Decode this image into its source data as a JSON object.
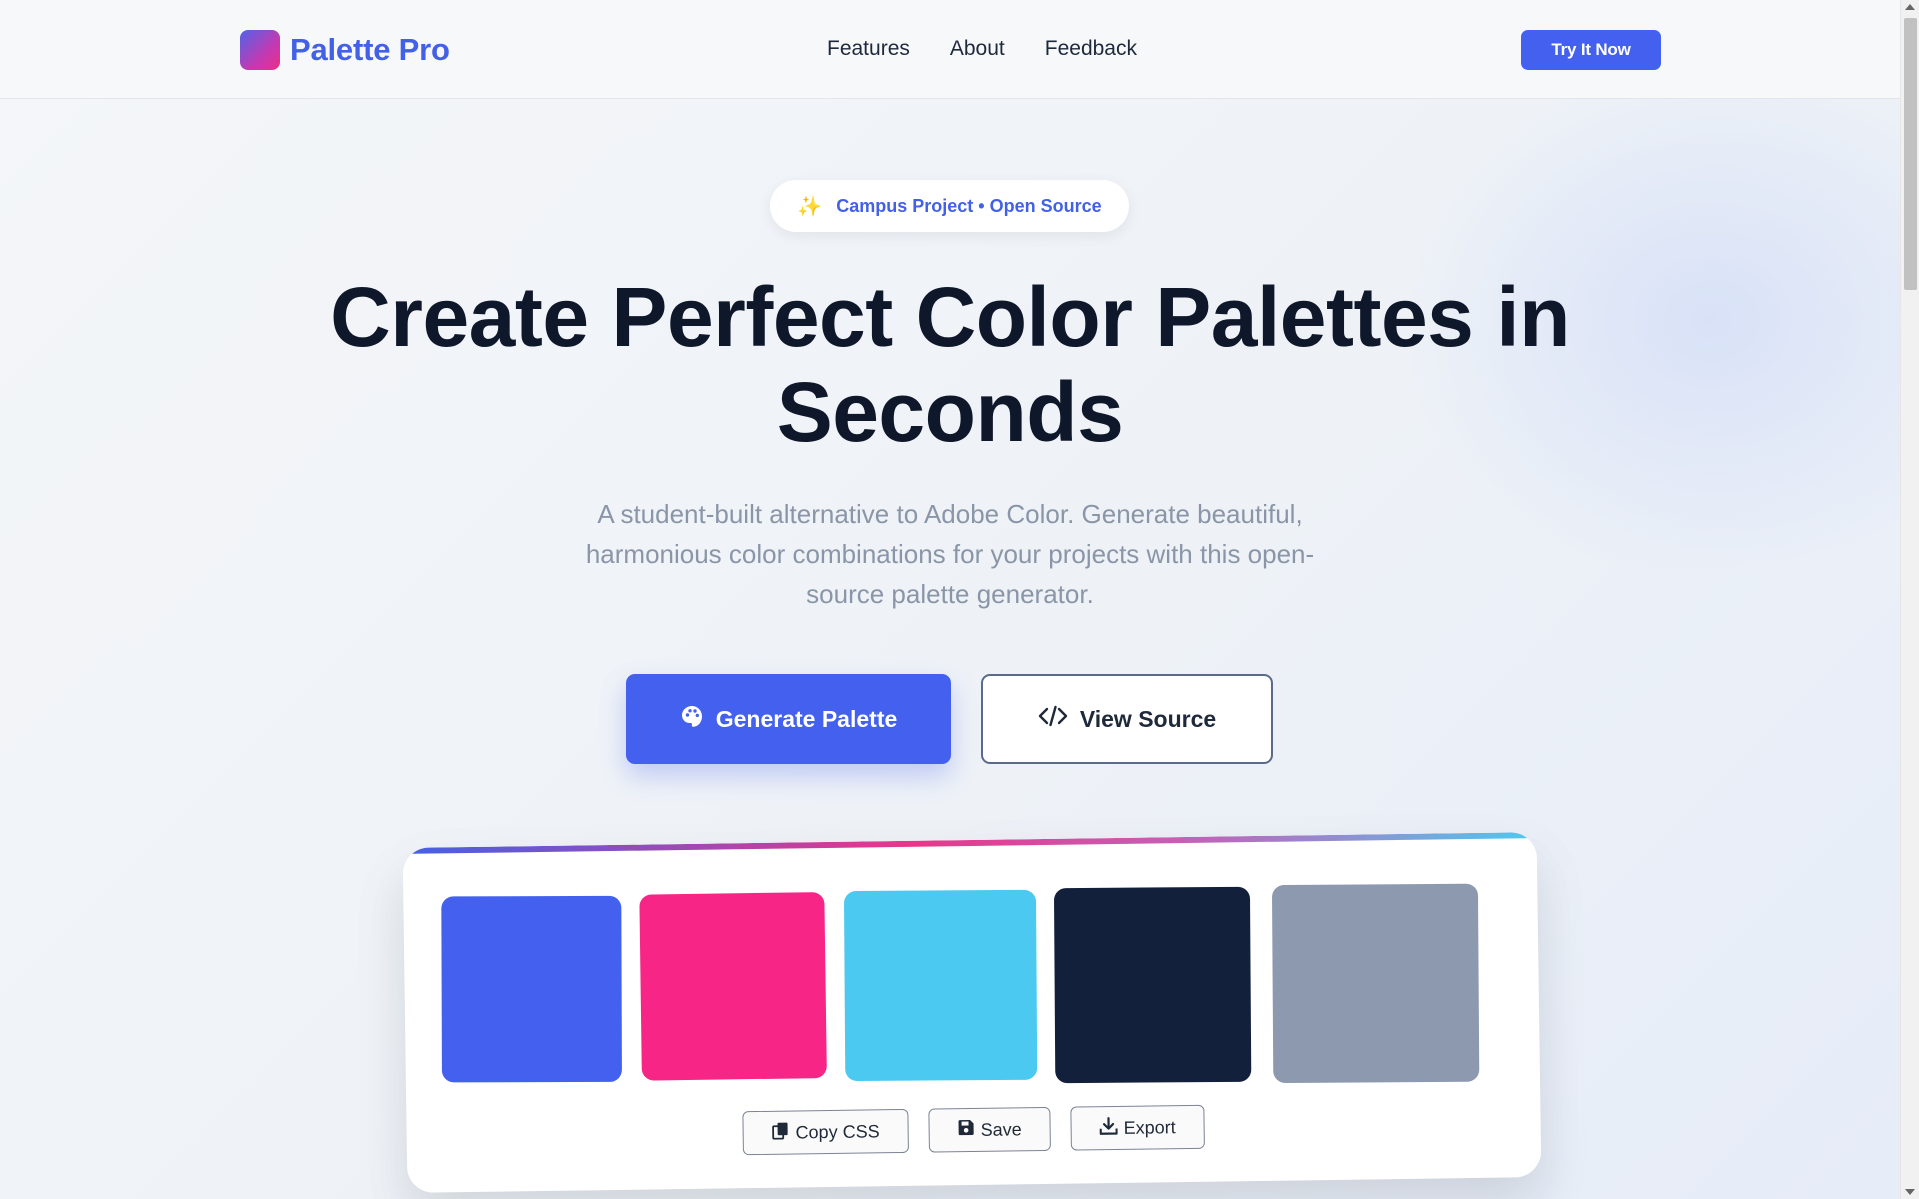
{
  "header": {
    "brand": "Palette Pro",
    "nav": [
      {
        "label": "Features"
      },
      {
        "label": "About"
      },
      {
        "label": "Feedback"
      }
    ],
    "cta": "Try It Now"
  },
  "hero": {
    "badge": "Campus Project • Open Source",
    "title": "Create Perfect Color Palettes in Seconds",
    "subtitle": "A student-built alternative to Adobe Color. Generate beautiful, harmonious color combinations for your projects with this open-source palette generator.",
    "primary_button": "Generate Palette",
    "secondary_button": "View Source"
  },
  "palette": {
    "swatches": [
      {
        "color": "#4361ee"
      },
      {
        "color": "#f72585"
      },
      {
        "color": "#4cc9f0"
      },
      {
        "color": "#13203b"
      },
      {
        "color": "#8d99ae"
      }
    ],
    "actions": [
      {
        "label": "Copy CSS",
        "icon": "copy-icon"
      },
      {
        "label": "Save",
        "icon": "save-icon"
      },
      {
        "label": "Export",
        "icon": "download-icon"
      }
    ]
  },
  "colors": {
    "brand": "#4361e6",
    "primary_button": "#4460ee",
    "text": "#0f172a",
    "muted": "#8a96a8"
  }
}
